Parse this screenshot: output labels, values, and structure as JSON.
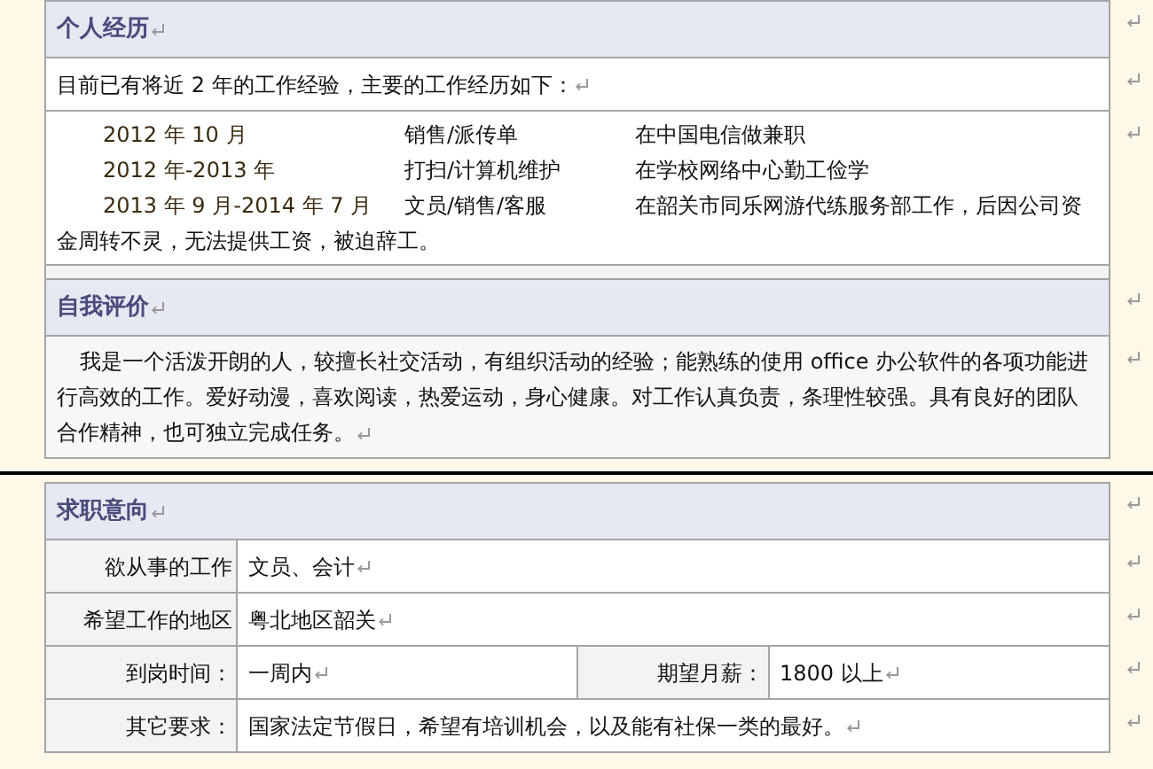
{
  "experience": {
    "title": "个人经历",
    "intro": "目前已有将近 2 年的工作经验，主要的工作经历如下：",
    "entries": [
      {
        "date": "2012 年 10 月",
        "role": "销售/派传单",
        "place": "在中国电信做兼职"
      },
      {
        "date": "2012 年-2013 年",
        "role": "打扫/计算机维护",
        "place": "在学校网络中心勤工俭学"
      },
      {
        "date": "2013 年 9 月-2014 年 7 月",
        "role": "文员/销售/客服",
        "place": "在韶关市同乐网游代练服务部工作，后因公司资金周转不灵，无法提供工资，被迫辞工。"
      }
    ]
  },
  "self_evaluation": {
    "title": "自我评价",
    "text": "我是一个活泼开朗的人，较擅长社交活动，有组织活动的经验；能熟练的使用 office 办公软件的各项功能进行高效的工作。爱好动漫，喜欢阅读，热爱运动，身心健康。对工作认真负责，条理性较强。具有良好的团队合作精神，也可独立完成任务。"
  },
  "job_intention": {
    "title": "求职意向",
    "rows": [
      {
        "cells": [
          {
            "label": "欲从事的工作",
            "value": "文员、会计"
          }
        ]
      },
      {
        "cells": [
          {
            "label": "希望工作的地区",
            "value": "粤北地区韶关"
          }
        ]
      },
      {
        "cells": [
          {
            "label": "到岗时间：",
            "value": "一周内"
          },
          {
            "label": "期望月薪：",
            "value": "1800 以上"
          }
        ]
      },
      {
        "cells": [
          {
            "label": "其它要求：",
            "value": "国家法定节假日，希望有培训机会，以及能有社保一类的最好。"
          }
        ]
      }
    ]
  }
}
